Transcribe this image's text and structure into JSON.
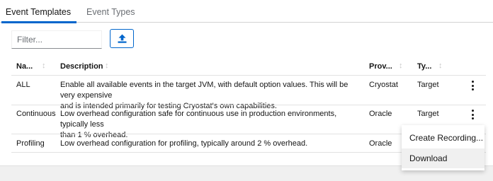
{
  "tabs": [
    {
      "label": "Event Templates",
      "active": true
    },
    {
      "label": "Event Types",
      "active": false
    }
  ],
  "toolbar": {
    "filter_placeholder": "Filter...",
    "upload_icon": "upload-icon"
  },
  "table": {
    "columns": [
      "Na...",
      "Description",
      "Prov...",
      "Ty..."
    ],
    "rows": [
      {
        "name": "ALL",
        "description_line1": "Enable all available events in the target JVM, with default option values. This will be very expensive",
        "description_line2": "and is intended primarily for testing Cryostat's own capabilities.",
        "provider": "Cryostat",
        "type": "Target"
      },
      {
        "name": "Continuous",
        "description_line1": "Low overhead configuration safe for continuous use in production environments, typically less",
        "description_line2": "than 1 % overhead.",
        "provider": "Oracle",
        "type": "Target"
      },
      {
        "name": "Profiling",
        "description_line1": "Low overhead configuration for profiling, typically around 2 % overhead.",
        "description_line2": "",
        "provider": "Oracle",
        "type": ""
      }
    ]
  },
  "menu": {
    "items": [
      "Create Recording...",
      "Download"
    ]
  },
  "colors": {
    "accent": "#0066cc",
    "text": "#151515",
    "muted": "#6a6e73"
  }
}
